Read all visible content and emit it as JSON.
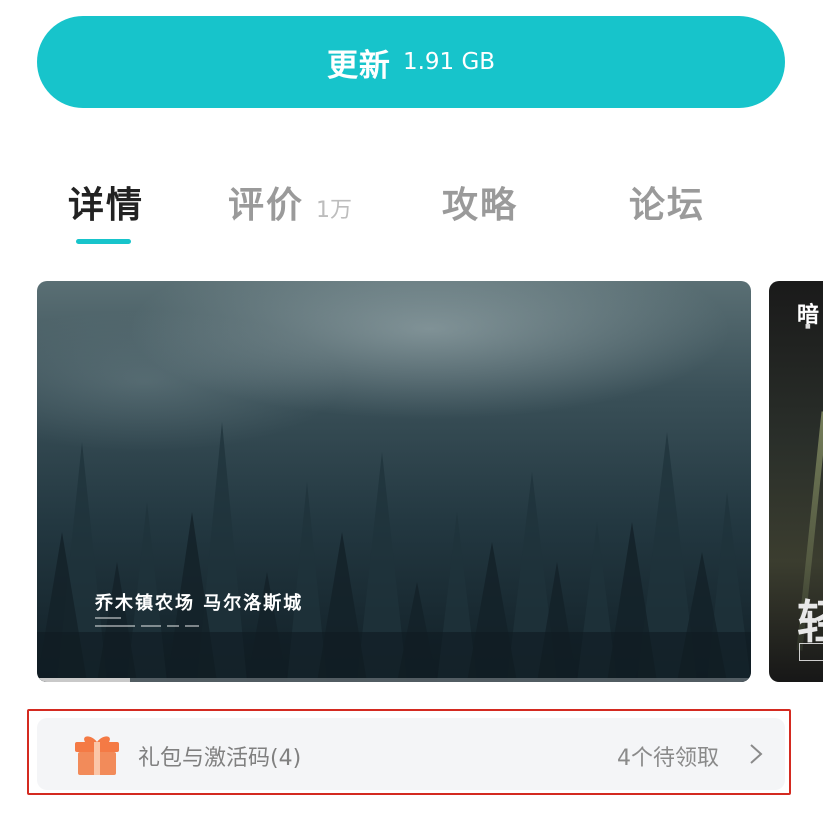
{
  "update_button": {
    "label": "更新",
    "size": "1.91 GB"
  },
  "tabs": [
    {
      "label": "详情",
      "count": ""
    },
    {
      "label": "评价",
      "count": "1万"
    },
    {
      "label": "攻略",
      "count": ""
    },
    {
      "label": "论坛",
      "count": ""
    }
  ],
  "active_tab": "详情",
  "screenshots": {
    "main": {
      "caption": "乔木镇农场 马尔洛斯城",
      "progress": 0.13
    },
    "next": {
      "title_glyph": "暗",
      "big_glyph": "轻"
    }
  },
  "gift_row": {
    "label": "礼包与激活码(4)",
    "pending": "4个待领取",
    "icon": "gift-icon"
  },
  "colors": {
    "accent": "#17c4cb",
    "highlight": "#d42a20",
    "gift": "#f47a45"
  }
}
